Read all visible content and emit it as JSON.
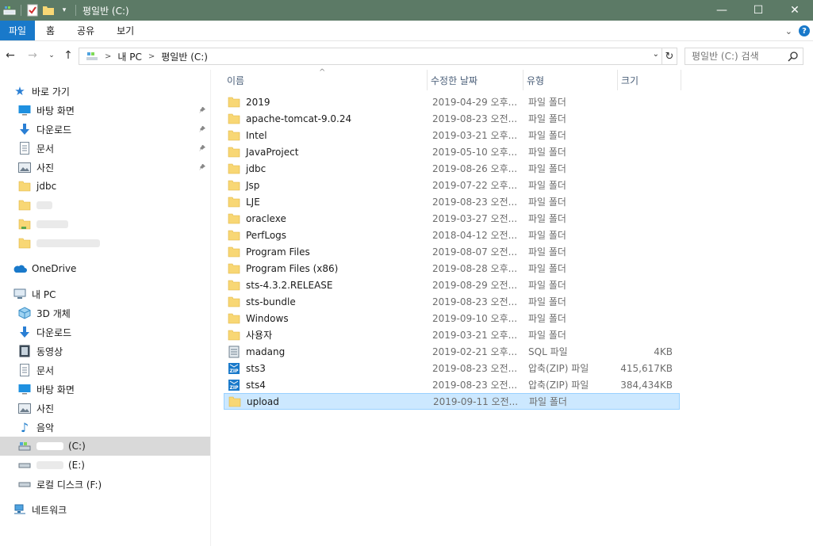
{
  "window": {
    "title": "평일반 (C:)",
    "controls": {
      "minimize": "—",
      "maximize": "☐",
      "close": "✕"
    }
  },
  "ribbon": {
    "tabs": [
      "파일",
      "홈",
      "공유",
      "보기"
    ],
    "expand_icon": "chevron-down-icon",
    "help_label": "?"
  },
  "address": {
    "crumbs": [
      "내 PC",
      "평일반 (C:)"
    ],
    "search_placeholder": "평일반 (C:) 검색"
  },
  "sidebar": {
    "quick_access_label": "바로 가기",
    "quick_access": [
      {
        "label": "바탕 화면",
        "icon": "desktop-icon",
        "pinned": true
      },
      {
        "label": "다운로드",
        "icon": "download-icon",
        "pinned": true
      },
      {
        "label": "문서",
        "icon": "document-icon",
        "pinned": true
      },
      {
        "label": "사진",
        "icon": "pictures-icon",
        "pinned": true
      },
      {
        "label": "jdbc",
        "icon": "folder-icon",
        "pinned": false
      }
    ],
    "onedrive_label": "OneDrive",
    "this_pc_label": "내 PC",
    "this_pc_items": [
      {
        "label": "3D 개체",
        "icon": "3d-objects-icon"
      },
      {
        "label": "다운로드",
        "icon": "download-icon"
      },
      {
        "label": "동영상",
        "icon": "video-icon"
      },
      {
        "label": "문서",
        "icon": "document-icon"
      },
      {
        "label": "바탕 화면",
        "icon": "desktop-icon"
      },
      {
        "label": "사진",
        "icon": "pictures-icon"
      },
      {
        "label": "음악",
        "icon": "music-icon"
      }
    ],
    "drives": [
      {
        "label": "(C:)",
        "selected": true
      },
      {
        "label": "(E:)",
        "selected": false
      },
      {
        "label": "로컬 디스크 (F:)",
        "selected": false
      }
    ],
    "network_label": "네트워크"
  },
  "filelist": {
    "columns": {
      "name": "이름",
      "date": "수정한 날짜",
      "type": "유형",
      "size": "크기"
    },
    "rows": [
      {
        "name": "2019",
        "date": "2019-04-29 오후...",
        "type": "파일 폴더",
        "size": "",
        "icon": "folder-icon"
      },
      {
        "name": "apache-tomcat-9.0.24",
        "date": "2019-08-23 오전...",
        "type": "파일 폴더",
        "size": "",
        "icon": "folder-icon"
      },
      {
        "name": "Intel",
        "date": "2019-03-21 오후...",
        "type": "파일 폴더",
        "size": "",
        "icon": "folder-icon"
      },
      {
        "name": "JavaProject",
        "date": "2019-05-10 오후...",
        "type": "파일 폴더",
        "size": "",
        "icon": "folder-icon"
      },
      {
        "name": "jdbc",
        "date": "2019-08-26 오후...",
        "type": "파일 폴더",
        "size": "",
        "icon": "folder-icon"
      },
      {
        "name": "Jsp",
        "date": "2019-07-22 오후...",
        "type": "파일 폴더",
        "size": "",
        "icon": "folder-icon"
      },
      {
        "name": "LJE",
        "date": "2019-08-23 오전...",
        "type": "파일 폴더",
        "size": "",
        "icon": "folder-icon"
      },
      {
        "name": "oraclexe",
        "date": "2019-03-27 오전...",
        "type": "파일 폴더",
        "size": "",
        "icon": "folder-icon"
      },
      {
        "name": "PerfLogs",
        "date": "2018-04-12 오전...",
        "type": "파일 폴더",
        "size": "",
        "icon": "folder-icon"
      },
      {
        "name": "Program Files",
        "date": "2019-08-07 오전...",
        "type": "파일 폴더",
        "size": "",
        "icon": "folder-icon"
      },
      {
        "name": "Program Files (x86)",
        "date": "2019-08-28 오후...",
        "type": "파일 폴더",
        "size": "",
        "icon": "folder-icon"
      },
      {
        "name": "sts-4.3.2.RELEASE",
        "date": "2019-08-29 오전...",
        "type": "파일 폴더",
        "size": "",
        "icon": "folder-icon"
      },
      {
        "name": "sts-bundle",
        "date": "2019-08-23 오전...",
        "type": "파일 폴더",
        "size": "",
        "icon": "folder-icon"
      },
      {
        "name": "Windows",
        "date": "2019-09-10 오후...",
        "type": "파일 폴더",
        "size": "",
        "icon": "folder-icon"
      },
      {
        "name": "사용자",
        "date": "2019-03-21 오후...",
        "type": "파일 폴더",
        "size": "",
        "icon": "folder-icon"
      },
      {
        "name": "madang",
        "date": "2019-02-21 오후...",
        "type": "SQL 파일",
        "size": "4KB",
        "icon": "sql-file-icon"
      },
      {
        "name": "sts3",
        "date": "2019-08-23 오전...",
        "type": "압축(ZIP) 파일",
        "size": "415,617KB",
        "icon": "zip-file-icon"
      },
      {
        "name": "sts4",
        "date": "2019-08-23 오전...",
        "type": "압축(ZIP) 파일",
        "size": "384,434KB",
        "icon": "zip-file-icon"
      },
      {
        "name": "upload",
        "date": "2019-09-11 오전...",
        "type": "파일 폴더",
        "size": "",
        "icon": "folder-icon",
        "selected": true
      }
    ]
  },
  "colors": {
    "titlebar": "#5c7a66",
    "file_tab": "#1979ca",
    "selection": "#cce8ff",
    "folder": "#f8d775"
  }
}
